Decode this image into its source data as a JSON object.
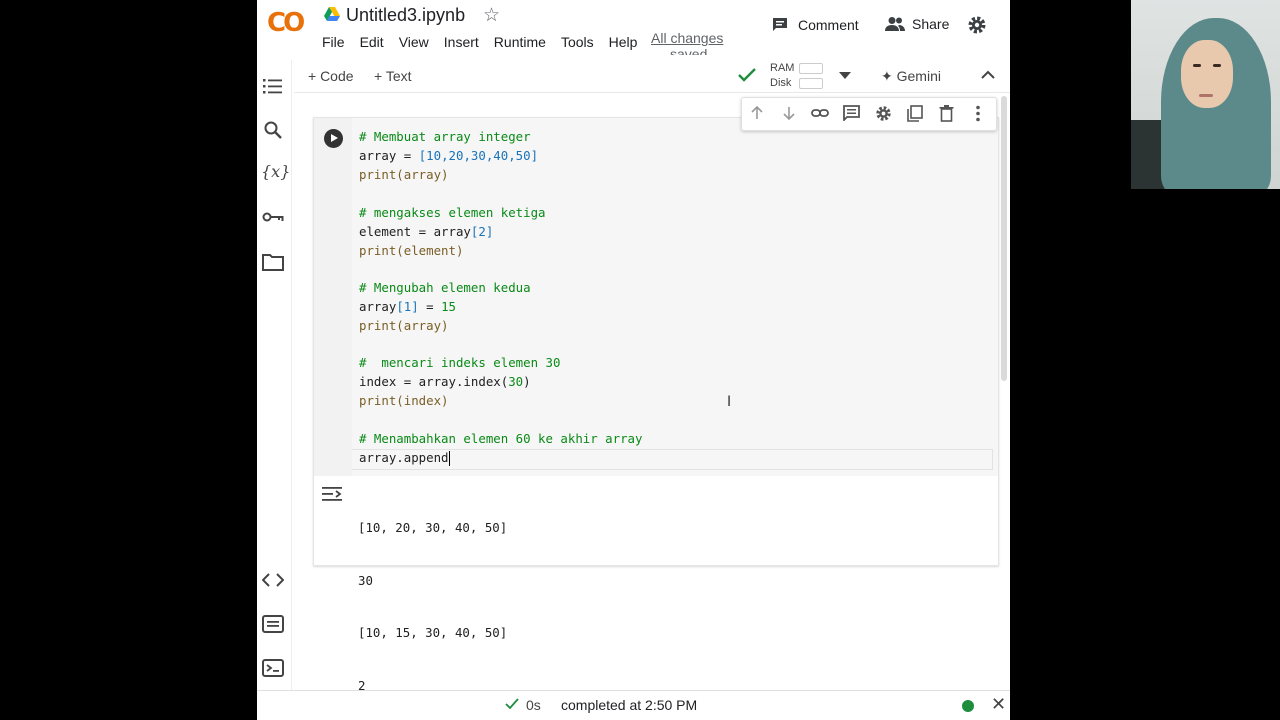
{
  "app": {
    "logo": "CO",
    "title": "Untitled3.ipynb",
    "menu": [
      "File",
      "Edit",
      "View",
      "Insert",
      "Runtime",
      "Tools",
      "Help"
    ],
    "save_status_line1": "All changes",
    "save_status_line2": "saved",
    "comment_label": "Comment",
    "share_label": "Share"
  },
  "toolbar": {
    "add_code": "+ Code",
    "add_text": "+ Text",
    "ram_label": "RAM",
    "disk_label": "Disk",
    "gemini_label": "Gemini"
  },
  "cell": {
    "code_lines": [
      "# Membuat array integer",
      "array = [10,20,30,40,50]",
      "print(array)",
      "",
      "# mengakses elemen ketiga",
      "element = array[2]",
      "print(element)",
      "",
      "# Mengubah elemen kedua",
      "array[1] = 15",
      "print(array)",
      "",
      "#  mencari indeks elemen 30",
      "index = array.index(30)",
      "print(index)",
      "",
      "# Menambahkan elemen 60 ke akhir array",
      "array.append"
    ],
    "output_lines": [
      "[10, 20, 30, 40, 50]",
      "30",
      "[10, 15, 30, 40, 50]",
      "2"
    ]
  },
  "status": {
    "elapsed": "0s",
    "completed": "completed at 2:50 PM"
  },
  "colors": {
    "comment": "#0a8a17",
    "bracket": "#1a73b8",
    "status_dot": "#1e8e3e",
    "logo_orange": "#f9ab00"
  }
}
